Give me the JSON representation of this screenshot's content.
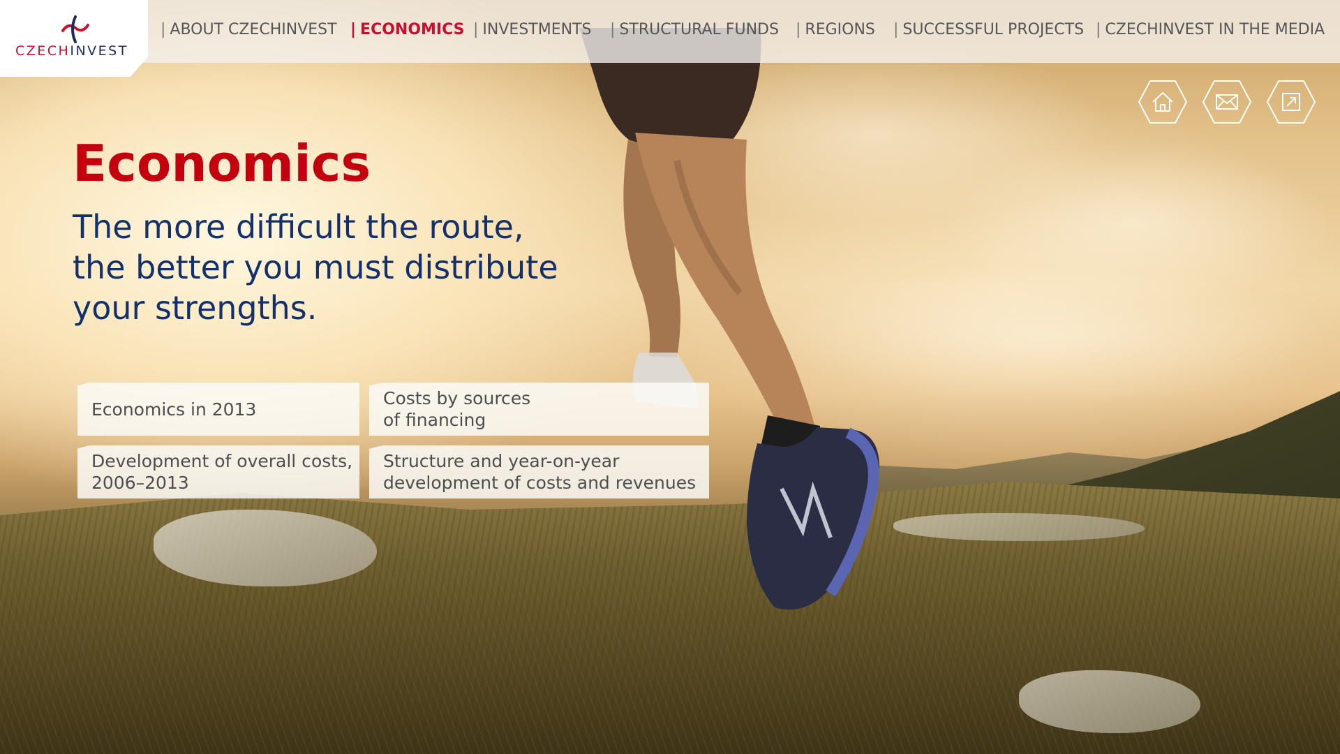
{
  "logo": {
    "part1": "CZECH",
    "part2": "INVEST"
  },
  "nav": {
    "separator": "|",
    "items": [
      {
        "label": "ABOUT CZECHINVEST",
        "active": false
      },
      {
        "label": "ECONOMICS",
        "active": true
      },
      {
        "label": "INVESTMENTS",
        "active": false
      },
      {
        "label": "STRUCTURAL FUNDS",
        "active": false
      },
      {
        "label": "REGIONS",
        "active": false
      },
      {
        "label": "SUCCESSFUL PROJECTS",
        "active": false
      },
      {
        "label": "CZECHINVEST IN THE MEDIA",
        "active": false
      }
    ]
  },
  "icons": {
    "home": "home-icon",
    "mail": "mail-icon",
    "share": "share-icon",
    "color": "#ffffff"
  },
  "hero": {
    "title": "Economics",
    "tagline": [
      "The more difficult the route,",
      "the better you must distribute",
      "your strengths."
    ]
  },
  "links": [
    {
      "lines": [
        "Economics in 2013"
      ]
    },
    {
      "lines": [
        "Costs by sources",
        "of financing"
      ]
    },
    {
      "lines": [
        "Development of overall costs,",
        "2006–2013"
      ]
    },
    {
      "lines": [
        "Structure and year-on-year",
        "development of costs and revenues"
      ]
    }
  ],
  "colors": {
    "brand_red": "#c4000f",
    "brand_blue": "#14306b",
    "nav_text": "#555555"
  }
}
